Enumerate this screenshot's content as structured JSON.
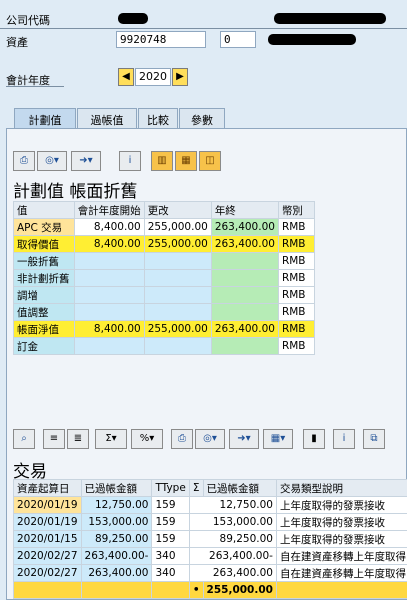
{
  "header": {
    "company_code_label": "公司代碼",
    "asset_label": "資產",
    "asset_number": "9920748",
    "asset_subnumber": "0",
    "fiscal_year_label": "會計年度",
    "fiscal_year": "2020",
    "prev_icon": "arrow-left-icon",
    "next_icon": "arrow-right-icon"
  },
  "tabs": [
    {
      "label": "計劃值"
    },
    {
      "label": "過帳值"
    },
    {
      "label": "比較"
    },
    {
      "label": "參數"
    }
  ],
  "toolbar1_icons": [
    "print-icon",
    "settings-icon",
    "export-icon",
    "info-icon",
    "layout-icon",
    "calculator-icon",
    "chart-icon"
  ],
  "planned": {
    "title": "計劃值 帳面折舊",
    "headers": [
      "值",
      "會計年度開始",
      "更改",
      "年終",
      "幣別"
    ],
    "rows": [
      {
        "label": "APC 交易",
        "start": "8,400.00",
        "change": "255,000.00",
        "end": "263,400.00",
        "cur": "RMB"
      },
      {
        "label": "取得價值",
        "start": "8,400.00",
        "change": "255,000.00",
        "end": "263,400.00",
        "cur": "RMB"
      },
      {
        "label": "一般折舊",
        "start": "",
        "change": "",
        "end": "",
        "cur": "RMB"
      },
      {
        "label": "非計劃折舊",
        "start": "",
        "change": "",
        "end": "",
        "cur": "RMB"
      },
      {
        "label": "調增",
        "start": "",
        "change": "",
        "end": "",
        "cur": "RMB"
      },
      {
        "label": "值調整",
        "start": "",
        "change": "",
        "end": "",
        "cur": "RMB"
      },
      {
        "label": "帳面淨值",
        "start": "8,400.00",
        "change": "255,000.00",
        "end": "263,400.00",
        "cur": "RMB"
      },
      {
        "label": "訂金",
        "start": "",
        "change": "",
        "end": "",
        "cur": "RMB"
      }
    ]
  },
  "toolbar2_icons": [
    "find-icon",
    "sort-asc-icon",
    "sort-desc-icon",
    "sum-icon",
    "subtotal-icon",
    "print-icon",
    "settings-icon",
    "export-icon",
    "grid-icon",
    "chart-icon",
    "info-icon",
    "copy-icon"
  ],
  "transactions": {
    "title": "交易",
    "headers": [
      "資產起算日",
      "已過帳金額",
      "TType",
      "Σ",
      "已過帳金額",
      "交易類型說明"
    ],
    "rows": [
      {
        "date": "2020/01/19",
        "amount": "12,750.00",
        "ttype": "159",
        "amount2": "12,750.00",
        "desc": "上年度取得的發票接收"
      },
      {
        "date": "2020/01/19",
        "amount": "153,000.00",
        "ttype": "159",
        "amount2": "153,000.00",
        "desc": "上年度取得的發票接收"
      },
      {
        "date": "2020/01/15",
        "amount": "89,250.00",
        "ttype": "159",
        "amount2": "89,250.00",
        "desc": "上年度取得的發票接收"
      },
      {
        "date": "2020/02/27",
        "amount": "263,400.00-",
        "ttype": "340",
        "amount2": "263,400.00-",
        "desc": "自在建資產移轉上年度取得"
      },
      {
        "date": "2020/02/27",
        "amount": "263,400.00",
        "ttype": "340",
        "amount2": "263,400.00",
        "desc": "自在建資產移轉上年度取得"
      }
    ],
    "total_marker": "•",
    "total": "255,000.00"
  }
}
